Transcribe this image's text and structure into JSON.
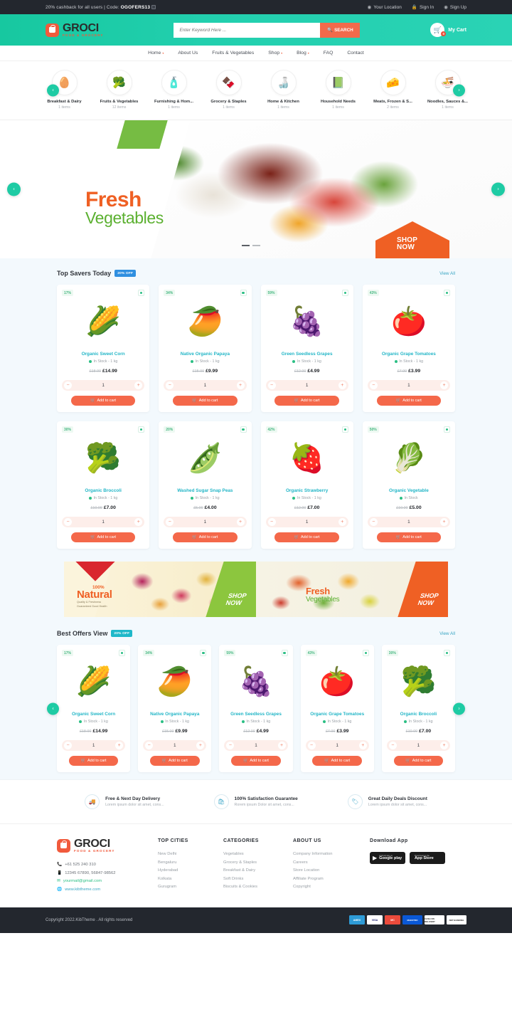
{
  "topbar": {
    "promo_prefix": "20% cashback for all users | Code: ",
    "promo_code": "OGOFERS13",
    "location": "Your Location",
    "signin": "Sign In",
    "signup": "Sign Up"
  },
  "header": {
    "logo_name": "GROCI",
    "logo_tagline": "FOOD & GROCERY",
    "search_placeholder": "Enter Keyword Here ...",
    "search_button": "SEARCH",
    "cart_label": "My Cart",
    "cart_count": "0"
  },
  "nav": [
    {
      "label": "Home",
      "caret": "▾"
    },
    {
      "label": "About Us",
      "caret": ""
    },
    {
      "label": "Fruits & Vegetables",
      "caret": ""
    },
    {
      "label": "Shop",
      "caret": "▾"
    },
    {
      "label": "Blog",
      "caret": "▾"
    },
    {
      "label": "FAQ",
      "caret": ""
    },
    {
      "label": "Contact",
      "caret": ""
    }
  ],
  "categories": [
    {
      "name": "Breakfast & Dairy",
      "count": "1 items",
      "icon": "🥚"
    },
    {
      "name": "Fruits & Vegetables",
      "count": "12 items",
      "icon": "🥦"
    },
    {
      "name": "Furnishing & Hom...",
      "count": "1 items",
      "icon": "🧴"
    },
    {
      "name": "Grocery & Staples",
      "count": "1 items",
      "icon": "🍫"
    },
    {
      "name": "Home & Kitchen",
      "count": "1 items",
      "icon": "🍶"
    },
    {
      "name": "Household Needs",
      "count": "1 items",
      "icon": "📗"
    },
    {
      "name": "Meats, Frozen & S...",
      "count": "2 items",
      "icon": "🧀"
    },
    {
      "name": "Noodles, Sauces &...",
      "count": "1 items",
      "icon": "🍜"
    }
  ],
  "hero": {
    "title_line1": "Fresh",
    "title_line2": "Vegetables",
    "cta_line1": "SHOP",
    "cta_line2": "NOW"
  },
  "top_savers": {
    "title": "Top Savers Today",
    "badge": "20% OFF",
    "badge_color": "#2f8fe0",
    "view_all": "View All",
    "products": [
      {
        "discount": "17%",
        "name": "Organic Sweet Corn",
        "stock": "In Stock - 1 kg",
        "old": "£18.00",
        "new": "£14.99",
        "qty": "1",
        "cta": "Add to cart",
        "icon": "🌽"
      },
      {
        "discount": "34%",
        "name": "Native Organic Papaya",
        "stock": "In Stock - 1 kg",
        "old": "£15.00",
        "new": "£9.99",
        "qty": "1",
        "cta": "Add to cart",
        "icon": "🥭"
      },
      {
        "discount": "59%",
        "name": "Green Seedless Grapes",
        "stock": "In Stock - 1 kg",
        "old": "£12.00",
        "new": "£4.99",
        "qty": "1",
        "cta": "Add to cart",
        "icon": "🍇"
      },
      {
        "discount": "43%",
        "name": "Organic Grape Tomatoes",
        "stock": "In Stock - 1 kg",
        "old": "£7.00",
        "new": "£3.99",
        "qty": "1",
        "cta": "Add to cart",
        "icon": "🍅"
      },
      {
        "discount": "30%",
        "name": "Organic Broccoli",
        "stock": "In Stock - 1 kg",
        "old": "£10.00",
        "new": "£7.00",
        "qty": "1",
        "cta": "Add to cart",
        "icon": "🥦"
      },
      {
        "discount": "20%",
        "name": "Washed Sugar Snap Peas",
        "stock": "In Stock - 1 kg",
        "old": "£5.00",
        "new": "£4.00",
        "qty": "1",
        "cta": "Add to cart",
        "icon": "🫛"
      },
      {
        "discount": "42%",
        "name": "Organic Strawberry",
        "stock": "In Stock - 1 kg",
        "old": "£12.00",
        "new": "£7.00",
        "qty": "1",
        "cta": "Add to cart",
        "icon": "🍓"
      },
      {
        "discount": "50%",
        "name": "Organic Vegetable",
        "stock": "In Stock",
        "old": "£10.00",
        "new": "£5.00",
        "qty": "1",
        "cta": "Add to cart",
        "icon": "🥬"
      }
    ]
  },
  "banners": [
    {
      "pre": "100%",
      "title": "Natural",
      "sub1": "Quality & Freshness",
      "sub2": "Guaranteed Good Health",
      "cta1": "SHOP",
      "cta2": "NOW"
    },
    {
      "title1": "Fresh",
      "title2": "Vegetables",
      "cta1": "SHOP",
      "cta2": "NOW"
    }
  ],
  "best_offers": {
    "title": "Best Offers View",
    "badge": "20% OFF",
    "badge_color": "#1fb8c9",
    "view_all": "View All",
    "products": [
      {
        "discount": "17%",
        "name": "Organic Sweet Corn",
        "stock": "In Stock - 1 kg",
        "old": "£18.00",
        "new": "£14.99",
        "qty": "1",
        "cta": "Add to cart",
        "icon": "🌽"
      },
      {
        "discount": "34%",
        "name": "Native Organic Papaya",
        "stock": "In Stock - 1 kg",
        "old": "£15.00",
        "new": "£9.99",
        "qty": "1",
        "cta": "Add to cart",
        "icon": "🥭"
      },
      {
        "discount": "59%",
        "name": "Green Seedless Grapes",
        "stock": "In Stock - 1 kg",
        "old": "£12.00",
        "new": "£4.99",
        "qty": "1",
        "cta": "Add to cart",
        "icon": "🍇"
      },
      {
        "discount": "43%",
        "name": "Organic Grape Tomatoes",
        "stock": "In Stock - 1 kg",
        "old": "£7.00",
        "new": "£3.99",
        "qty": "1",
        "cta": "Add to cart",
        "icon": "🍅"
      },
      {
        "discount": "30%",
        "name": "Organic Broccoli",
        "stock": "In Stock - 1 kg",
        "old": "£10.00",
        "new": "£7.00",
        "qty": "1",
        "cta": "Add to cart",
        "icon": "🥦"
      }
    ]
  },
  "features": [
    {
      "icon": "🚚",
      "title": "Free & Next Day Delivery",
      "sub": "Lorem ipsum dolor sit amet, cons..."
    },
    {
      "icon": "🛍",
      "title": "100% Satisfaction Guarantee",
      "sub": "Rorem ipsum Dolor sit amet, cons..."
    },
    {
      "icon": "🏷",
      "title": "Great Daily Deals Discount",
      "sub": "Lorem ipsum dolor sit amet, cons..."
    }
  ],
  "footer": {
    "logo_name": "GROCI",
    "logo_tagline": "FOOD & GROCERY",
    "phone": "+61 525 240 310",
    "mobile": "12345 67890, 56847-98562",
    "email": "yourmail@gmail.com",
    "website": "www.kibtheme.com",
    "columns": [
      {
        "head": "TOP CITIES",
        "items": [
          "New Delhi",
          "Bengaluru",
          "Hyderabad",
          "Kolkata",
          "Gurugram"
        ]
      },
      {
        "head": "CATEGORIES",
        "items": [
          "Vegetables",
          "Grocery & Staples",
          "Breakfast & Dairy",
          "Soft Drinks",
          "Biscuits & Cookies"
        ]
      },
      {
        "head": "ABOUT US",
        "items": [
          "Company Information",
          "Careers",
          "Store Location",
          "Affiliate Program",
          "Copyright"
        ]
      }
    ],
    "download_head": "Download App",
    "store_google_small": "Android app on",
    "store_google_big": "Google play",
    "store_apple_small": "Download on the",
    "store_apple_big": "App Store"
  },
  "copyright": {
    "text": "Copyright 2022.KibTheme . All rights reserved",
    "payments": [
      {
        "label": "AMEX",
        "bg": "#2e9bd6",
        "fg": "#ffffff"
      },
      {
        "label": "VISA",
        "bg": "#ffffff",
        "fg": "#1a1f71"
      },
      {
        "label": "MC",
        "bg": "#eb4b3c",
        "fg": "#ffffff"
      },
      {
        "label": "MAESTRO",
        "bg": "#0a58d6",
        "fg": "#ffffff"
      },
      {
        "label": "CASH ON DELIVERY",
        "bg": "#ffffff",
        "fg": "#2b2b2b"
      },
      {
        "label": "NET BANKING",
        "bg": "#ffffff",
        "fg": "#2b2b2b"
      }
    ]
  }
}
